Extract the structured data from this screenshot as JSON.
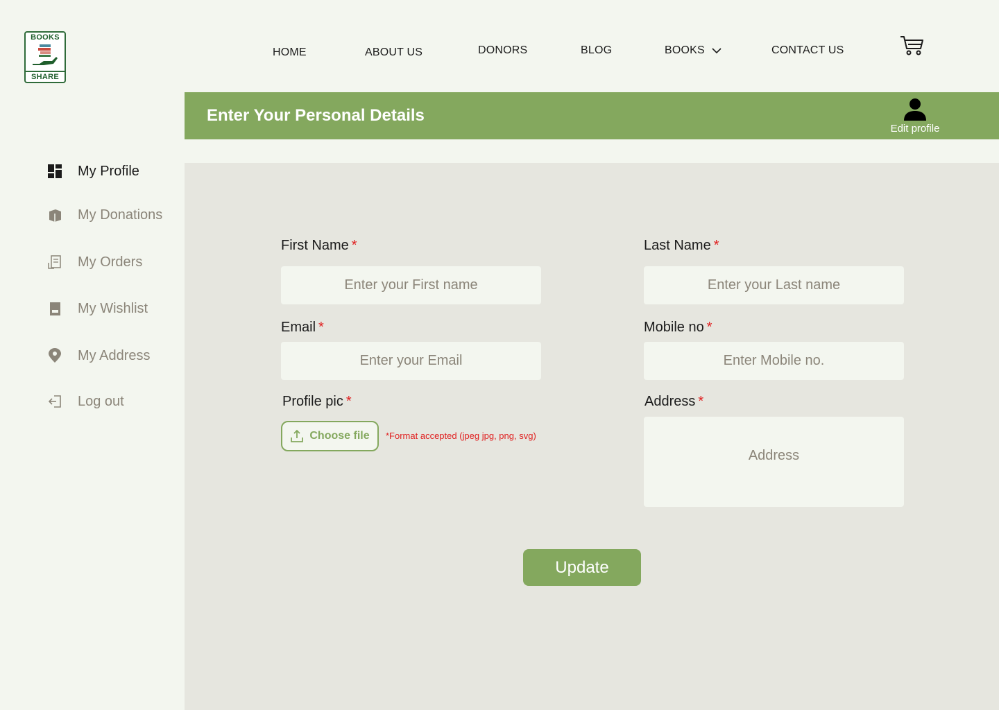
{
  "brand": {
    "logo_top": "BOOKS",
    "logo_bottom": "SHARE",
    "accent_color": "#84a85e",
    "required_color": "#e02020"
  },
  "nav": {
    "home": "HOME",
    "about": "ABOUT US",
    "donors": "DONORS",
    "blog": "BLOG",
    "books": "BOOKS",
    "contact": "CONTACT US",
    "cart_icon": "cart-icon"
  },
  "banner": {
    "title": "Enter Your Personal Details",
    "edit_profile": "Edit profile"
  },
  "sidebar": {
    "items": [
      {
        "label": "My Profile",
        "icon": "dashboard-icon",
        "active": true
      },
      {
        "label": "My Donations",
        "icon": "book-icon"
      },
      {
        "label": "My Orders",
        "icon": "receipt-icon"
      },
      {
        "label": "My Wishlist",
        "icon": "wishlist-icon"
      },
      {
        "label": "My Address",
        "icon": "location-icon"
      },
      {
        "label": "Log out",
        "icon": "logout-icon"
      }
    ]
  },
  "form": {
    "first_name": {
      "label": "First Name",
      "required": "*",
      "placeholder": "Enter your First name"
    },
    "last_name": {
      "label": "Last Name",
      "required": "*",
      "placeholder": "Enter your Last name"
    },
    "email": {
      "label": "Email",
      "required": "*",
      "placeholder": "Enter your Email"
    },
    "mobile": {
      "label": "Mobile no",
      "required": "*",
      "placeholder": "Enter Mobile no."
    },
    "profile_pic": {
      "label": "Profile pic",
      "required": "*",
      "button": "Choose file",
      "note": "*Format accepted (jpeg  jpg, png, svg)"
    },
    "address": {
      "label": "Address",
      "required": "*",
      "placeholder": "Address"
    },
    "submit": "Update"
  }
}
